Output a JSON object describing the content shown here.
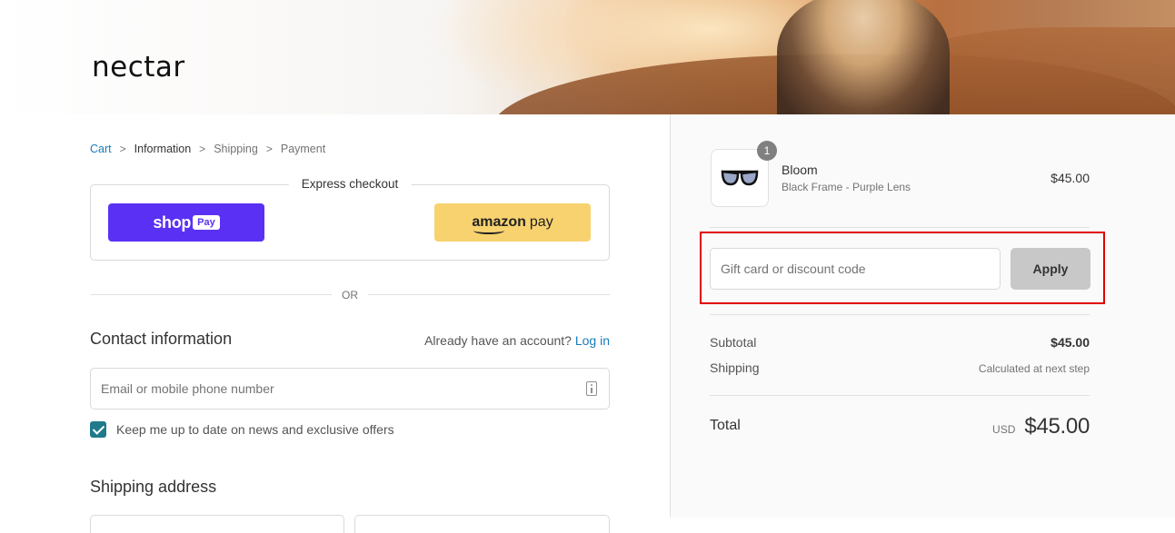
{
  "header": {
    "logo_text": "nectar"
  },
  "breadcrumb": {
    "items": [
      {
        "label": "Cart",
        "state": "link"
      },
      {
        "label": "Information",
        "state": "current"
      },
      {
        "label": "Shipping",
        "state": "upcoming"
      },
      {
        "label": "Payment",
        "state": "upcoming"
      }
    ],
    "separator": ">"
  },
  "express_checkout": {
    "title": "Express checkout",
    "shop_pay": {
      "shop": "shop",
      "pay": "Pay",
      "color": "#5a31f4"
    },
    "amazon_pay": {
      "amazon": "amazon",
      "pay": "pay",
      "color": "#f8d26f"
    }
  },
  "or_text": "OR",
  "contact": {
    "title": "Contact information",
    "account_prompt": "Already have an account?",
    "login_link": "Log in",
    "email_placeholder": "Email or mobile phone number",
    "email_value": "",
    "newsletter_label": "Keep me up to date on news and exclusive offers",
    "newsletter_checked": true
  },
  "shipping": {
    "title": "Shipping address"
  },
  "order_summary": {
    "product": {
      "quantity_badge": "1",
      "name": "Bloom",
      "variant": "Black Frame - Purple Lens",
      "price": "$45.00",
      "icon": "sunglasses-icon"
    },
    "discount": {
      "placeholder": "Gift card or discount code",
      "value": "",
      "apply_label": "Apply"
    },
    "subtotal_label": "Subtotal",
    "subtotal_value": "$45.00",
    "shipping_label": "Shipping",
    "shipping_value": "Calculated at next step",
    "total_label": "Total",
    "total_currency": "USD",
    "total_value": "$45.00"
  },
  "colors": {
    "link": "#197bbd",
    "highlight_border": "#e00000",
    "checkbox": "#1f7a8c"
  }
}
